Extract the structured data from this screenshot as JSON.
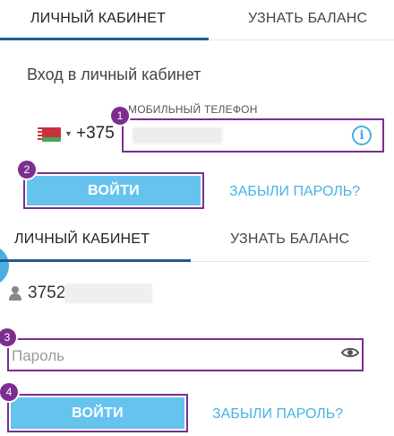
{
  "top_panel": {
    "tabs": [
      {
        "label": "ЛИЧНЫЙ КАБИНЕТ",
        "active": true
      },
      {
        "label": "УЗНАТЬ БАЛАНС",
        "active": false
      }
    ],
    "heading": "Вход в личный кабинет",
    "phone_label": "МОБИЛЬНЫЙ ТЕЛЕФОН",
    "country_code": "+375",
    "country_flag": "belarus-flag-icon",
    "info_icon": "info-icon",
    "login_button": "ВОЙТИ",
    "forgot_link": "ЗАБЫЛИ ПАРОЛЬ?"
  },
  "bottom_panel": {
    "tabs": [
      {
        "label": "ЛИЧНЫЙ КАБИНЕТ",
        "active": true
      },
      {
        "label": "УЗНАТЬ БАЛАНС",
        "active": false
      }
    ],
    "user_number": "3752",
    "user_icon": "user-icon",
    "password_placeholder": "Пароль",
    "eye_icon": "eye-icon",
    "login_button": "ВОЙТИ",
    "forgot_link": "ЗАБЫЛИ ПАРОЛЬ?"
  },
  "annotations": [
    "1",
    "2",
    "3",
    "4"
  ],
  "colors": {
    "accent_blue": "#65c3ee",
    "link_blue": "#47b3e3",
    "tab_underline": "#1f5a94",
    "annotation_purple": "#7b2e8f"
  }
}
